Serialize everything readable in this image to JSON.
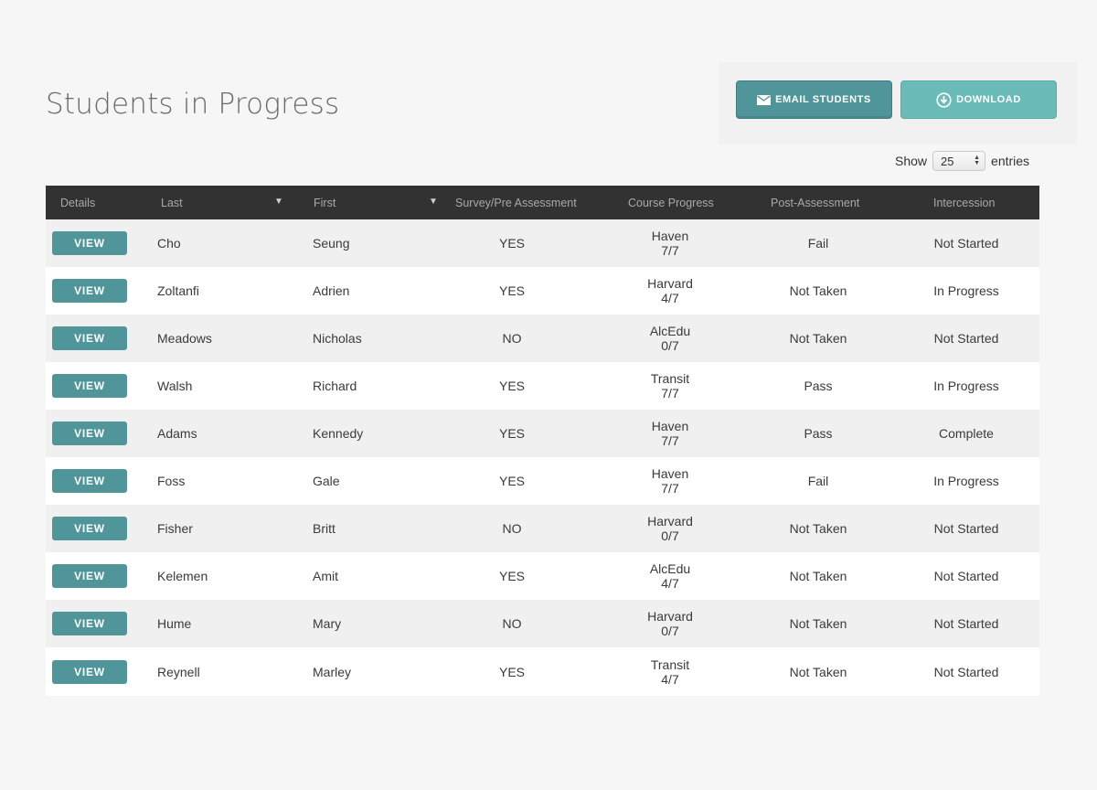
{
  "page": {
    "title": "Students in Progress"
  },
  "actions": {
    "email_label": "EMAIL STUDENTS",
    "download_label": "DOWNLOAD",
    "email_icon": "envelope-icon",
    "download_icon": "download-circle-icon"
  },
  "entries": {
    "show_label": "Show",
    "value": "25",
    "suffix_label": "entries"
  },
  "colors": {
    "accent": "#4f9599",
    "accent_light": "#6bbcb8",
    "header_bg": "#323232"
  },
  "table": {
    "columns": [
      "Details",
      "Last",
      "First",
      "Survey/Pre Assessment",
      "Course Progress",
      "Post-Assessment",
      "Intercession"
    ],
    "view_label": "VIEW",
    "rows": [
      {
        "last": "Cho",
        "first": "Seung",
        "survey": "YES",
        "course": "Haven",
        "progress": "7/7",
        "post": "Fail",
        "intercession": "Not Started"
      },
      {
        "last": "Zoltanfi",
        "first": "Adrien",
        "survey": "YES",
        "course": "Harvard",
        "progress": "4/7",
        "post": "Not Taken",
        "intercession": "In Progress"
      },
      {
        "last": "Meadows",
        "first": "Nicholas",
        "survey": "NO",
        "course": "AlcEdu",
        "progress": "0/7",
        "post": "Not Taken",
        "intercession": "Not Started"
      },
      {
        "last": "Walsh",
        "first": "Richard",
        "survey": "YES",
        "course": "Transit",
        "progress": "7/7",
        "post": "Pass",
        "intercession": "In Progress"
      },
      {
        "last": "Adams",
        "first": "Kennedy",
        "survey": "YES",
        "course": "Haven",
        "progress": "7/7",
        "post": "Pass",
        "intercession": "Complete"
      },
      {
        "last": "Foss",
        "first": "Gale",
        "survey": "YES",
        "course": "Haven",
        "progress": "7/7",
        "post": "Fail",
        "intercession": "In Progress"
      },
      {
        "last": "Fisher",
        "first": "Britt",
        "survey": "NO",
        "course": "Harvard",
        "progress": "0/7",
        "post": "Not Taken",
        "intercession": "Not Started"
      },
      {
        "last": "Kelemen",
        "first": "Amit",
        "survey": "YES",
        "course": "AlcEdu",
        "progress": "4/7",
        "post": "Not Taken",
        "intercession": "Not Started"
      },
      {
        "last": "Hume",
        "first": "Mary",
        "survey": "NO",
        "course": "Harvard",
        "progress": "0/7",
        "post": "Not Taken",
        "intercession": "Not Started"
      },
      {
        "last": "Reynell",
        "first": "Marley",
        "survey": "YES",
        "course": "Transit",
        "progress": "4/7",
        "post": "Not Taken",
        "intercession": "Not Started"
      }
    ]
  }
}
